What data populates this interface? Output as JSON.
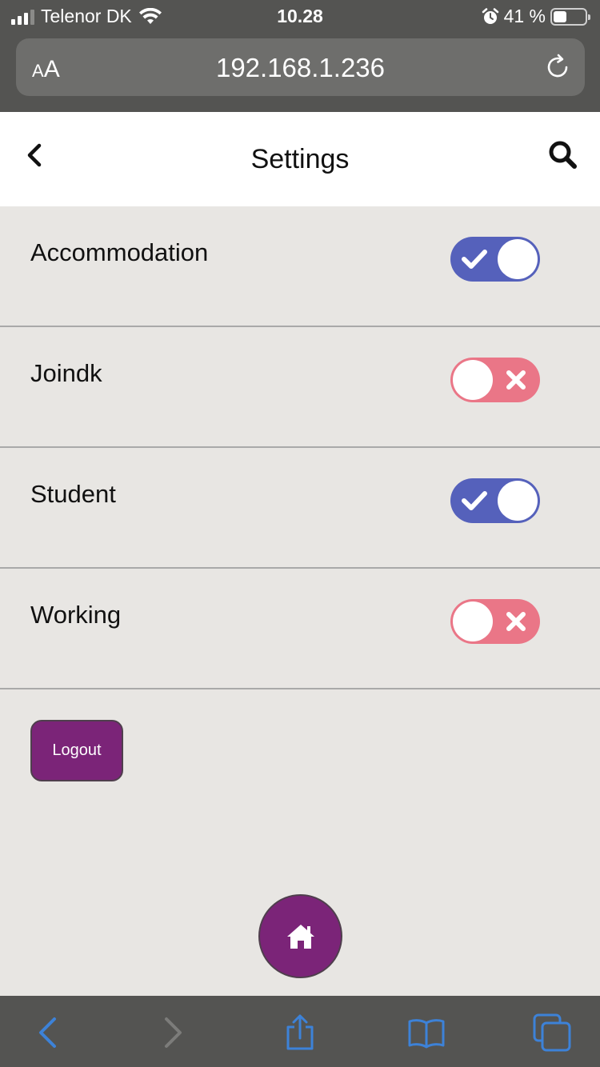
{
  "status": {
    "carrier": "Telenor DK",
    "time": "10.28",
    "battery": "41 %",
    "battery_level": 0.41
  },
  "browser": {
    "text_size_small": "A",
    "text_size_large": "A",
    "url": "192.168.1.236"
  },
  "header": {
    "title": "Settings"
  },
  "settings": [
    {
      "label": "Accommodation",
      "enabled": true
    },
    {
      "label": "Joindk",
      "enabled": false
    },
    {
      "label": "Student",
      "enabled": true
    },
    {
      "label": "Working",
      "enabled": false
    }
  ],
  "actions": {
    "logout_label": "Logout"
  },
  "colors": {
    "toggle_on": "#5561bb",
    "toggle_off": "#ea7687",
    "brand_purple": "#7b2478",
    "ios_blue": "#3d82d8"
  }
}
